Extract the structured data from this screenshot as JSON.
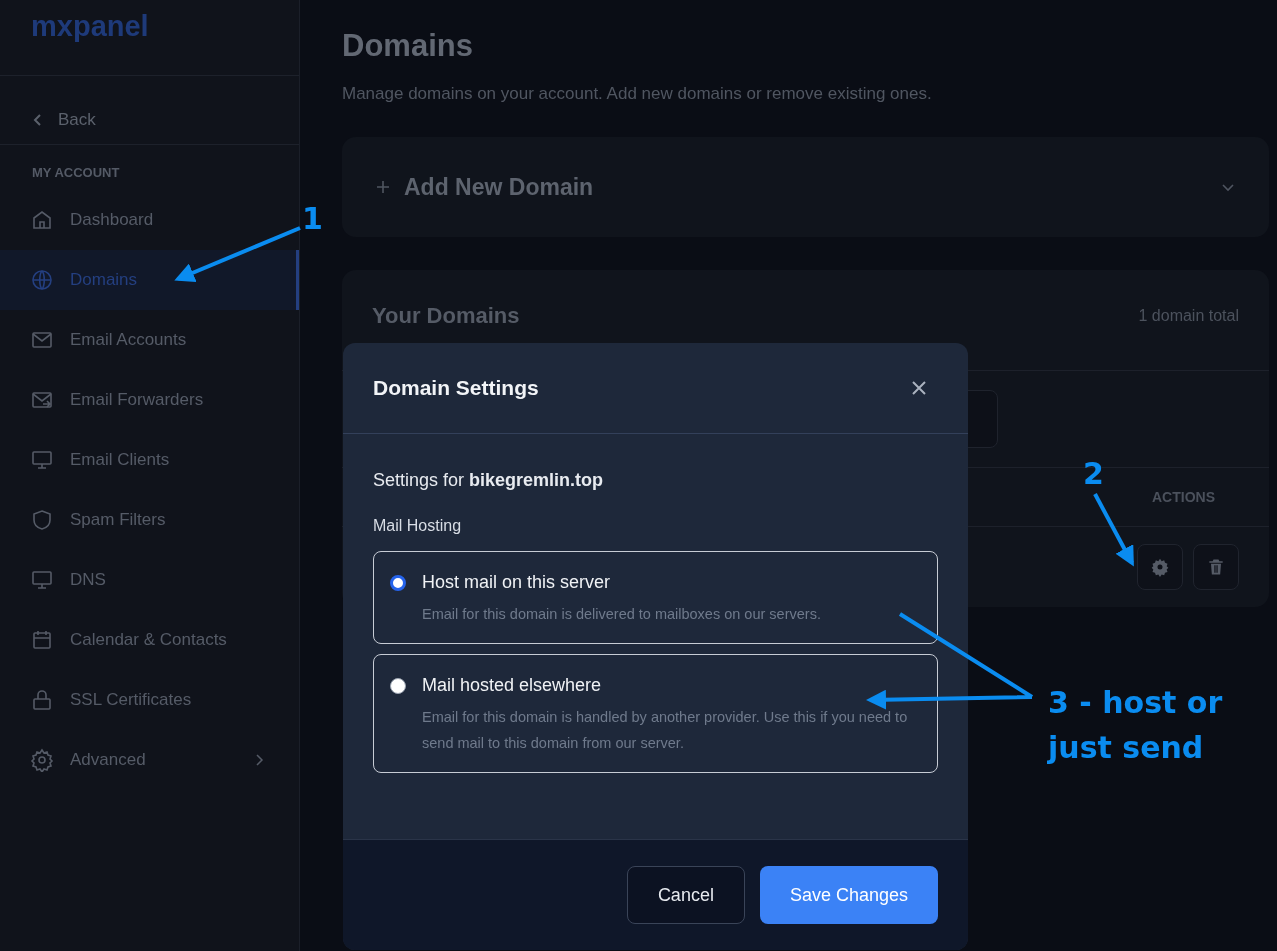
{
  "sidebar": {
    "logo": "mxpanel",
    "back": "Back",
    "section": "MY ACCOUNT",
    "items": [
      {
        "label": "Dashboard",
        "kind": "home",
        "selected": false,
        "expandable": false
      },
      {
        "label": "Domains",
        "kind": "globe",
        "selected": true,
        "expandable": false
      },
      {
        "label": "Email Accounts",
        "kind": "mail",
        "selected": false,
        "expandable": false
      },
      {
        "label": "Email Forwarders",
        "kind": "forward",
        "selected": false,
        "expandable": false
      },
      {
        "label": "Email Clients",
        "kind": "monitor",
        "selected": false,
        "expandable": false
      },
      {
        "label": "Spam Filters",
        "kind": "shield",
        "selected": false,
        "expandable": false
      },
      {
        "label": "DNS",
        "kind": "monitor",
        "selected": false,
        "expandable": false
      },
      {
        "label": "Calendar & Contacts",
        "kind": "calendar",
        "selected": false,
        "expandable": false
      },
      {
        "label": "SSL Certificates",
        "kind": "lock",
        "selected": false,
        "expandable": false
      },
      {
        "label": "Advanced",
        "kind": "gear",
        "selected": false,
        "expandable": true
      }
    ]
  },
  "main": {
    "title": "Domains",
    "subtitle": "Manage domains on your account. Add new domains or remove existing ones.",
    "add_card": {
      "label": "Add New Domain",
      "expanded": false
    },
    "domains_card": {
      "title": "Your Domains",
      "count": "1 domain total",
      "actions_column": "ACTIONS"
    }
  },
  "modal": {
    "title": "Domain Settings",
    "settings_for": "Settings for **bikegremlin.top**",
    "section_label": "Mail Hosting",
    "options": [
      {
        "title": "Host mail on this server",
        "description": "Email for this domain is delivered to mailboxes on our servers.",
        "selected": true
      },
      {
        "title": "Mail hosted elsewhere",
        "description": "Email for this domain is handled by another provider. Use this if you need to send mail to this domain from our server.",
        "selected": false
      }
    ],
    "buttons": [
      {
        "label": "Cancel",
        "kind": "secondary"
      },
      {
        "label": "Save Changes",
        "kind": "primary"
      }
    ]
  },
  "annotations": [
    {
      "label": "1"
    },
    {
      "label": "2"
    },
    {
      "label": "3 - host or just send"
    }
  ]
}
